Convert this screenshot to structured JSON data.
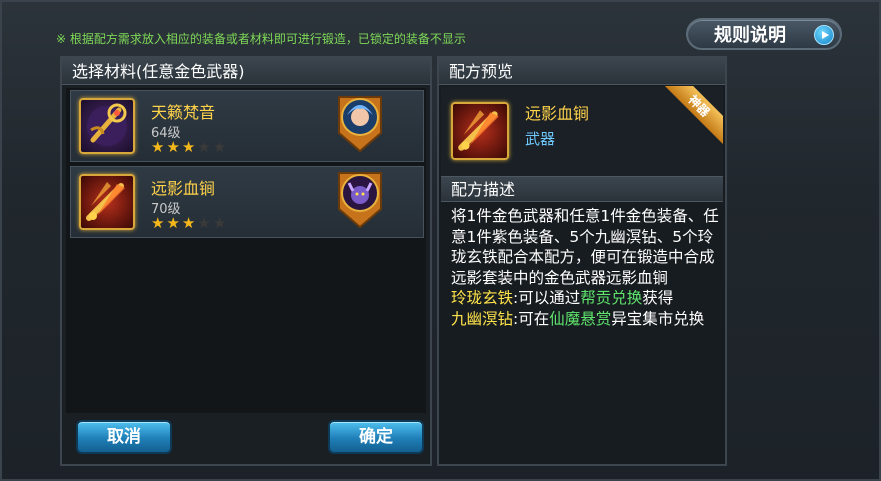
{
  "hint": "※ 根据配方需求放入相应的装备或者材料即可进行锻造，已锁定的装备不显示",
  "rules_button": "规则说明",
  "left_panel": {
    "title": "选择材料(任意金色武器)",
    "items": [
      {
        "name": "天籁梵音",
        "level": "64级",
        "stars": 3,
        "max_stars": 5,
        "icon": "golden-scepter-icon",
        "badge": "blue-hair-hero-portrait"
      },
      {
        "name": "远影血锏",
        "level": "70级",
        "stars": 3,
        "max_stars": 5,
        "icon": "red-flame-mace-icon",
        "badge": "purple-demon-hero-portrait"
      }
    ],
    "cancel": "取消",
    "confirm": "确定"
  },
  "right_panel": {
    "preview_title": "配方预览",
    "item_name": "远影血锏",
    "item_type": "武器",
    "ribbon": "神器",
    "desc_title": "配方描述",
    "desc_main": "将1件金色武器和任意1件金色装备、任意1件紫色装备、5个九幽溟钻、5个玲珑玄铁配合本配方，便可在锻造中合成远影套装中的金色武器远影血锏",
    "line1_label": "玲珑玄铁",
    "line1_text": ":可以通过",
    "line1_link": "帮贡兑换",
    "line1_tail": "获得",
    "line2_label": "九幽溟钻",
    "line2_text": ":可在",
    "line2_link": "仙魔悬赏",
    "line2_tail": "异宝集市兑换"
  },
  "colors": {
    "gold": "#ffd24a",
    "green": "#5ee36c",
    "blue": "#6ec8ff",
    "star": "#f5b81b"
  }
}
